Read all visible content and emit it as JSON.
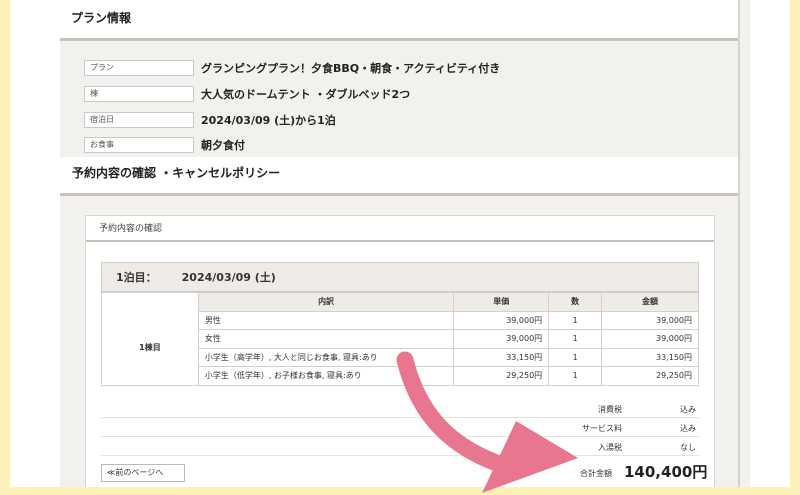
{
  "section1": {
    "title": "プラン情報"
  },
  "info": [
    {
      "label": "プラン",
      "value": "グランピングプラン！夕食BBQ・朝食・アクティビティ付き"
    },
    {
      "label": "棟",
      "value": "大人気のドームテント ・ダブルベッド2つ"
    },
    {
      "label": "宿泊日",
      "value": "2024/03/09 (土)から1泊"
    },
    {
      "label": "お食事",
      "value": "朝夕食付"
    }
  ],
  "section2": {
    "title": "予約内容の確認 ・キャンセルポリシー"
  },
  "card": {
    "title": "予約内容の確認",
    "night_label": "1泊目：",
    "night_date": "2024/03/09 (土)",
    "table": {
      "headers": [
        "内訳",
        "単価",
        "数",
        "金額"
      ],
      "room": "1棟目",
      "rows": [
        {
          "item": "男性",
          "unit": "39,000円",
          "qty": "1",
          "amount": "39,000円"
        },
        {
          "item": "女性",
          "unit": "39,000円",
          "qty": "1",
          "amount": "39,000円"
        },
        {
          "item": "小学生（高学年）, 大人と同じお食事, 寝具:あり",
          "unit": "33,150円",
          "qty": "1",
          "amount": "33,150円"
        },
        {
          "item": "小学生（低学年）, お子様お食事, 寝具:あり",
          "unit": "29,250円",
          "qty": "1",
          "amount": "29,250円"
        }
      ]
    },
    "taxes": [
      {
        "label": "消費税",
        "value": "込み"
      },
      {
        "label": "サービス料",
        "value": "込み"
      },
      {
        "label": "入湯税",
        "value": "なし"
      }
    ],
    "total_label": "合計金額",
    "total_value": "140,400円",
    "prev_button": "≪前のページへ"
  },
  "colors": {
    "background": "#fdf0b8",
    "arrow": "#e8768f"
  }
}
